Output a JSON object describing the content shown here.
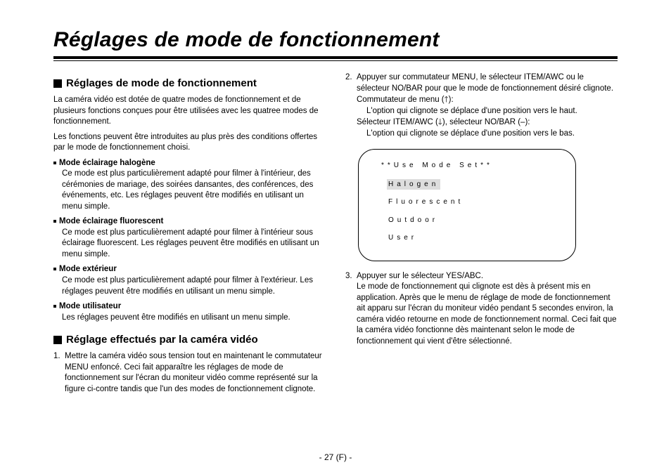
{
  "title": "Réglages de mode de fonctionnement",
  "footer": "- 27 (F) -",
  "left": {
    "h1": "Réglages de mode de fonctionnement",
    "intro1": "La caméra vidéo est dotée de quatre modes de fonctionnement et de plusieurs fonctions conçues pour être utilisées avec les quatree modes de fonctionnement.",
    "intro2": "Les fonctions peuvent être introduites au plus près des conditions offertes par le mode de fonctionnement choisi.",
    "modes": [
      {
        "title": "Mode éclairage halogène",
        "body": "Ce mode est plus particulièrement adapté pour filmer à l'intérieur, des cérémonies de mariage, des soirées dansantes, des conférences, des événements, etc. Les réglages peuvent être modifiés en utilisant un menu simple."
      },
      {
        "title": "Mode éclairage fluorescent",
        "body": "Ce mode est plus particulièrement adapté pour filmer à l'intérieur sous éclairage fluorescent. Les réglages peuvent être modifiés en utilisant un menu simple."
      },
      {
        "title": "Mode extérieur",
        "body": "Ce mode est plus particulièrement adapté pour filmer à l'extérieur. Les réglages peuvent être modifiés en utilisant un menu simple."
      },
      {
        "title": "Mode utilisateur",
        "body": "Les réglages peuvent être modifiés en utilisant un menu simple."
      }
    ],
    "h2": "Réglage effectués par la caméra vidéo",
    "step1": "Mettre la caméra vidéo sous tension tout en maintenant le commutateur MENU enfoncé. Ceci fait apparaître les réglages de mode de fonctionnement sur l'écran du moniteur vidéo comme représenté sur la figure ci-contre tandis que l'un des modes de fonctionnement clignote."
  },
  "right": {
    "step2a": "Appuyer sur commutateur MENU, le sélecteur ITEM/AWC ou le sélecteur NO/BAR pour que le mode de fonctionnement désiré clignote.",
    "step2b_label": "Commutateur de menu (",
    "step2b_up_icon": "🡑",
    "step2b_after": "):",
    "step2b_body": "L'option qui clignote se déplace d'une position vers le haut.",
    "step2c_label": "Sélecteur ITEM/AWC (",
    "step2c_down_icon": "🡓",
    "step2c_mid": "), sélecteur NO/BAR (–):",
    "step2c_body": "L'option qui clignote se déplace d'une position vers le bas.",
    "menu": {
      "title": "**Use Mode Set**",
      "items": [
        "Halogen",
        "Fluorescent",
        "Outdoor",
        "User"
      ],
      "selected_index": 0
    },
    "step3": "Appuyer sur le sélecteur YES/ABC.\nLe mode de fonctionnement qui clignote est dès à présent mis en application. Après que le menu de réglage de mode de fonctionnement ait apparu sur l'écran du moniteur vidéo pendant 5 secondes environ, la caméra vidéo retourne en mode de fonctionnement normal. Ceci fait que la caméra vidéo fonctionne dès maintenant selon le mode de fonctionnement qui vient d'être sélectionné."
  }
}
